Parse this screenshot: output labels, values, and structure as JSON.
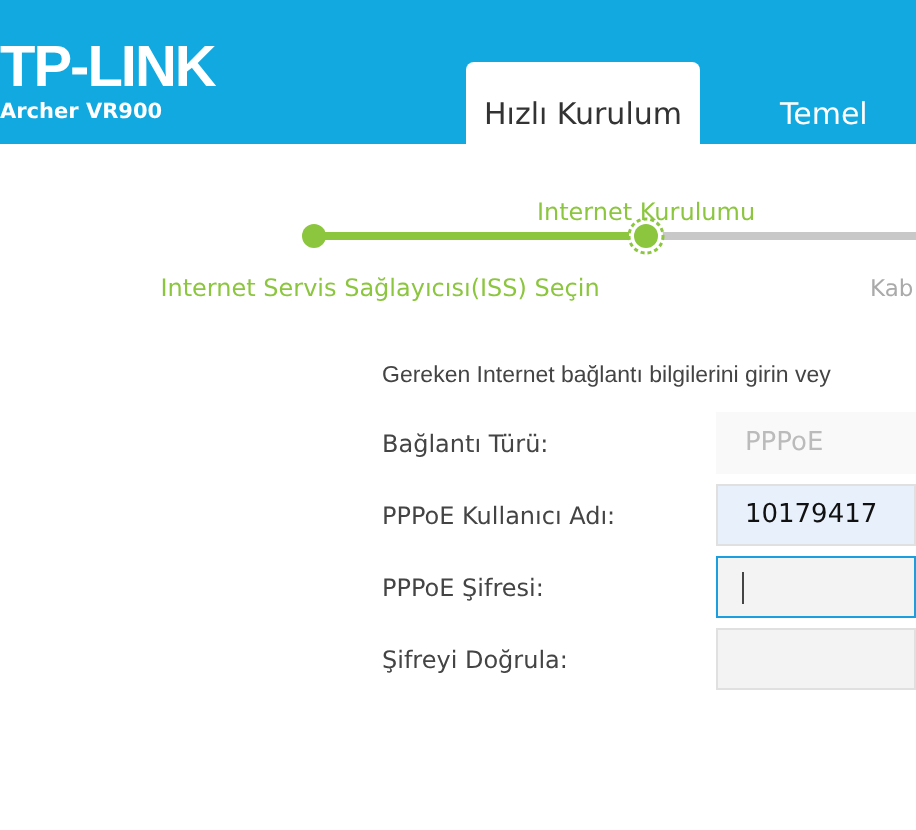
{
  "header": {
    "logo": "TP-LINK",
    "model": "Archer VR900"
  },
  "tabs": [
    {
      "label": "Hızlı Kurulum",
      "selected": true
    },
    {
      "label": "Temel",
      "selected": false
    }
  ],
  "steps": [
    {
      "label": "Internet Servis Sağlayıcısı(ISS) Seçin",
      "completed": true,
      "selected": false
    },
    {
      "label": "Internet Kurulumu",
      "completed": false,
      "selected": true
    },
    {
      "label": "Kab",
      "completed": false,
      "selected": false
    }
  ],
  "intro": "Gereken Internet bağlantı bilgilerini girin vey",
  "fields": [
    {
      "label": "Bağlantı Türü:",
      "value": "PPPoE",
      "kind": "readonly",
      "focused": false
    },
    {
      "label": "PPPoE Kullanıcı Adı:",
      "value": "10179417",
      "kind": "autofill",
      "focused": false
    },
    {
      "label": "PPPoE Şifresi:",
      "kind": "password",
      "focused": true
    },
    {
      "label": "Şifreyi Doğrula:",
      "kind": "password",
      "focused": false
    }
  ]
}
